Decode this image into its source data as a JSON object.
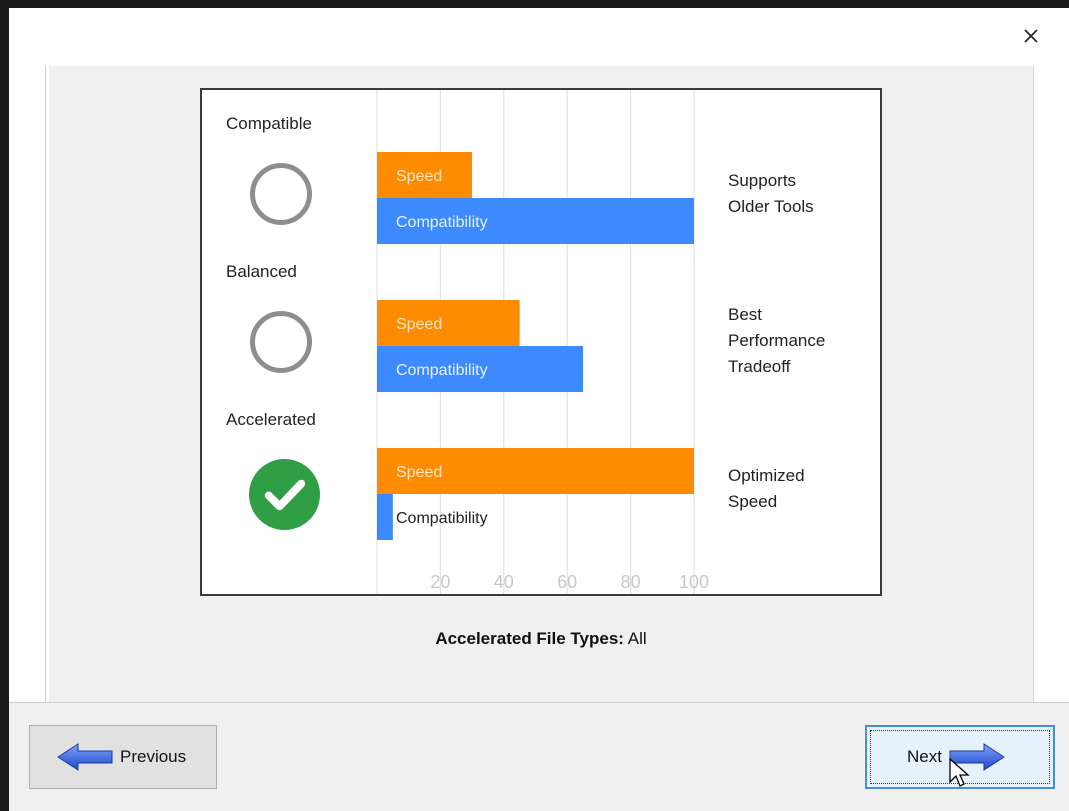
{
  "window": {
    "close_icon": "close-icon"
  },
  "chart_data": {
    "type": "bar",
    "orientation": "horizontal",
    "categories": [
      "Compatible",
      "Balanced",
      "Accelerated"
    ],
    "series": [
      {
        "name": "Speed",
        "values": [
          30,
          45,
          100
        ],
        "color": "#ff8c00"
      },
      {
        "name": "Compatibility",
        "values": [
          100,
          65,
          5
        ],
        "color": "#3d8aff"
      }
    ],
    "xticks": [
      "20",
      "40",
      "60",
      "80",
      "100"
    ],
    "xlim": [
      0,
      100
    ],
    "grid": true
  },
  "options": [
    {
      "label": "Compatible",
      "description": [
        "Supports",
        "Older Tools"
      ],
      "selected": false
    },
    {
      "label": "Balanced",
      "description": [
        "Best",
        "Performance",
        "Tradeoff"
      ],
      "selected": false
    },
    {
      "label": "Accelerated",
      "description": [
        "Optimized",
        "Speed"
      ],
      "selected": true
    }
  ],
  "footer": {
    "label": "Accelerated File Types:",
    "value": "All"
  },
  "buttons": {
    "previous": "Previous",
    "next": "Next"
  }
}
